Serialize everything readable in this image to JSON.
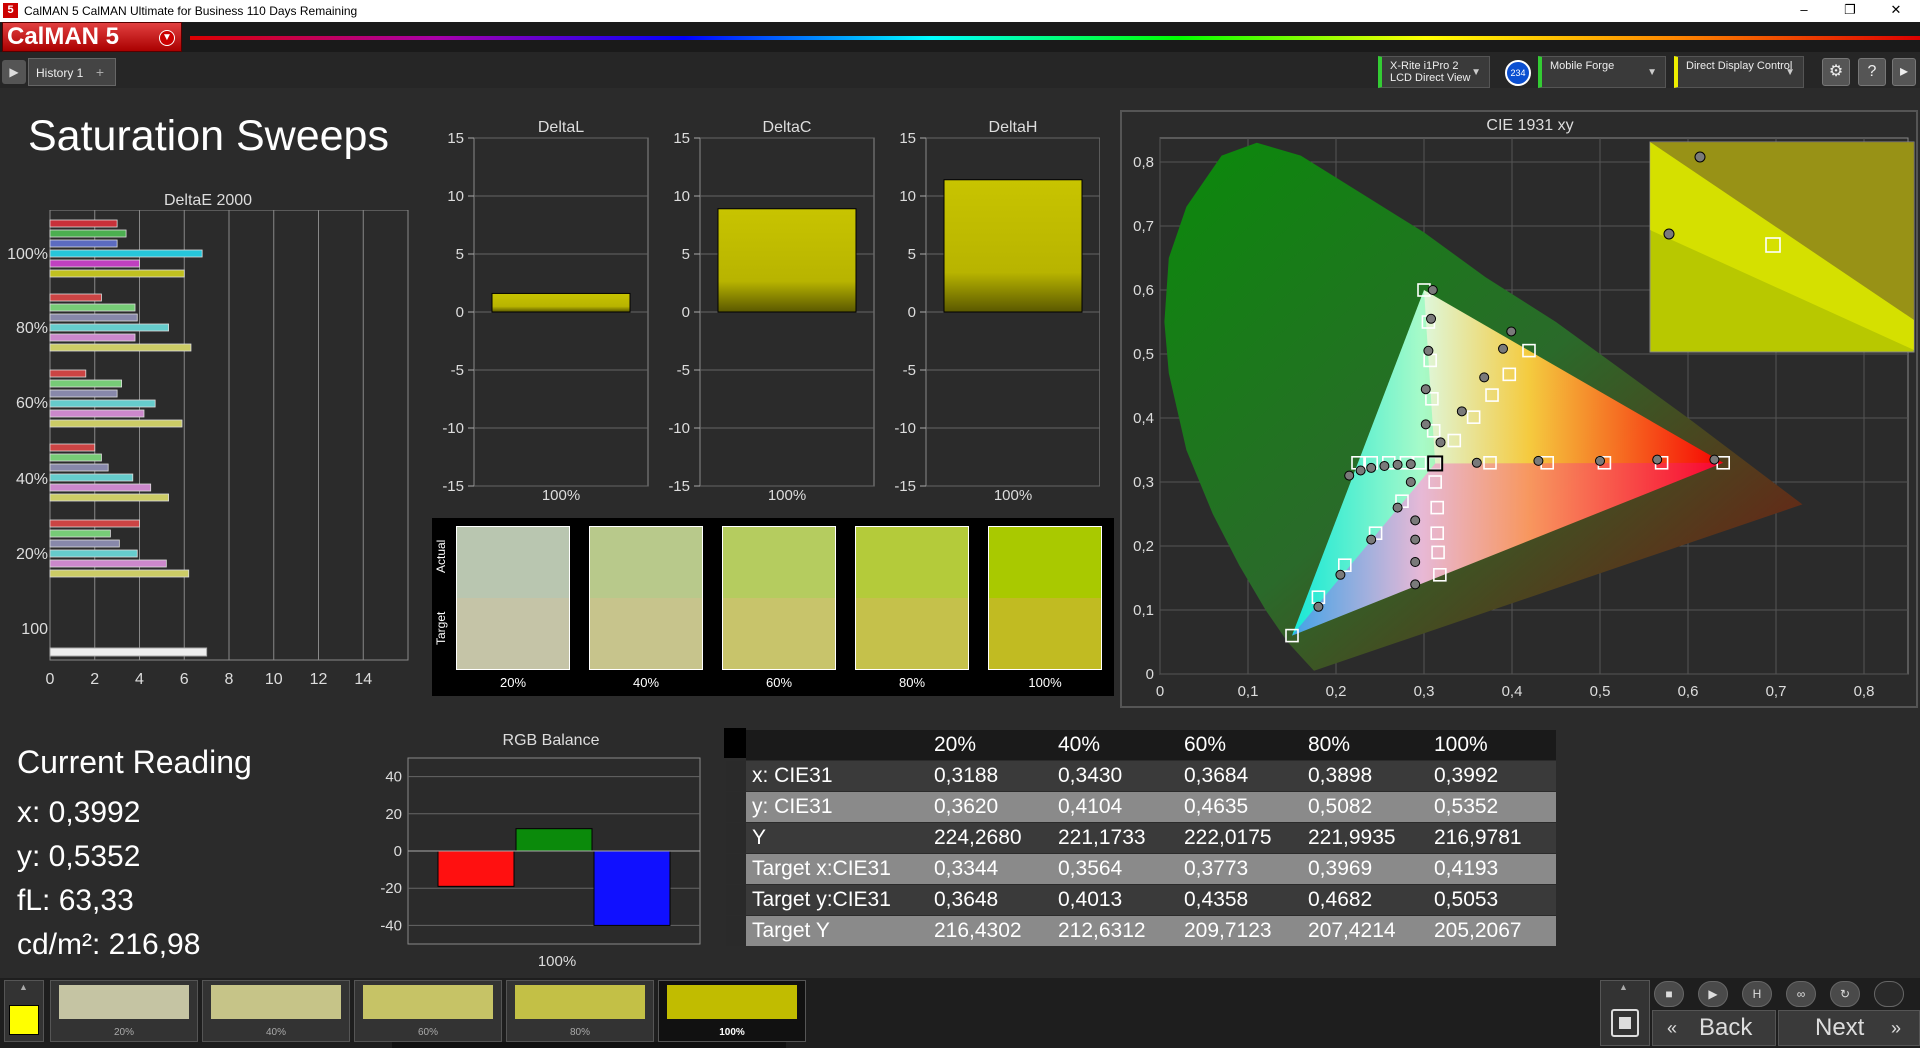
{
  "window": {
    "title": "CalMAN 5 CalMAN Ultimate for Business 110 Days Remaining",
    "app_icon": "5"
  },
  "logo": {
    "text": "CalMAN 5"
  },
  "tabs": {
    "history": "History 1",
    "add": "+"
  },
  "devices": [
    {
      "line1": "X-Rite i1Pro 2",
      "line2": "LCD Direct View",
      "accent": "#3c3"
    },
    {
      "line1": "Mobile Forge",
      "line2": "",
      "accent": "#3c3"
    },
    {
      "line1": "Direct Display Control",
      "line2": "",
      "accent": "#ee0"
    }
  ],
  "badge": "234",
  "toolbar_icons": [
    "gear-icon",
    "help-icon",
    "arrow-right-icon"
  ],
  "page_title": "Saturation Sweeps",
  "deltae_chart": {
    "title": "DeltaE 2000",
    "xticks": [
      "0",
      "2",
      "4",
      "6",
      "8",
      "10",
      "12",
      "14"
    ],
    "ylabels": [
      "100%",
      "80%",
      "60%",
      "40%",
      "20%",
      "100"
    ],
    "xlim": [
      0,
      16
    ]
  },
  "delta_charts": [
    {
      "title": "DeltaL",
      "value": 1.6,
      "xlabel": "100%"
    },
    {
      "title": "DeltaC",
      "value": 8.9,
      "xlabel": "100%"
    },
    {
      "title": "DeltaH",
      "value": 11.4,
      "xlabel": "100%"
    }
  ],
  "delta_yticks": [
    "15",
    "10",
    "5",
    "0",
    "-5",
    "-10",
    "-15"
  ],
  "swatches": {
    "actual_label": "Actual",
    "target_label": "Target",
    "items": [
      {
        "label": "20%",
        "actual": "#b9c6b0",
        "target": "#c5c4a7"
      },
      {
        "label": "40%",
        "actual": "#b8c98b",
        "target": "#c7c48c"
      },
      {
        "label": "60%",
        "actual": "#b5cc5f",
        "target": "#c8c46b"
      },
      {
        "label": "80%",
        "actual": "#b4cb3a",
        "target": "#c5c14b"
      },
      {
        "label": "100%",
        "actual": "#a9c900",
        "target": "#c1bb22"
      }
    ]
  },
  "cie": {
    "title": "CIE 1931 xy",
    "xticks": [
      "0",
      "0,1",
      "0,2",
      "0,3",
      "0,4",
      "0,5",
      "0,6",
      "0,7",
      "0,8"
    ],
    "yticks": [
      "0,8",
      "0,7",
      "0,6",
      "0,5",
      "0,4",
      "0,3",
      "0,2",
      "0,1",
      "0"
    ]
  },
  "current_reading": {
    "title": "Current Reading",
    "x": "x: 0,3992",
    "y": "y: 0,5352",
    "fl": "fL: 63,33",
    "cdm2": "cd/m²: 216,98"
  },
  "rgb_balance": {
    "title": "RGB Balance",
    "yticks": [
      "40",
      "20",
      "0",
      "-20",
      "-40"
    ],
    "xlabel": "100%",
    "values": {
      "red": -19,
      "green": 12,
      "blue": -40
    }
  },
  "table": {
    "headers": [
      "",
      "20%",
      "40%",
      "60%",
      "80%",
      "100%"
    ],
    "rows": [
      [
        "x: CIE31",
        "0,3188",
        "0,3430",
        "0,3684",
        "0,3898",
        "0,3992"
      ],
      [
        "y: CIE31",
        "0,3620",
        "0,4104",
        "0,4635",
        "0,5082",
        "0,5352"
      ],
      [
        "Y",
        "224,2680",
        "221,1733",
        "222,0175",
        "221,9935",
        "216,9781"
      ],
      [
        "Target x:CIE31",
        "0,3344",
        "0,3564",
        "0,3773",
        "0,3969",
        "0,4193"
      ],
      [
        "Target y:CIE31",
        "0,3648",
        "0,4013",
        "0,4358",
        "0,4682",
        "0,5053"
      ],
      [
        "Target Y",
        "216,4302",
        "212,6312",
        "209,7123",
        "207,4214",
        "205,2067"
      ]
    ]
  },
  "bottom_swatches": [
    {
      "label": "20%",
      "color": "#c5c4a3"
    },
    {
      "label": "40%",
      "color": "#c6c488"
    },
    {
      "label": "60%",
      "color": "#c6c366"
    },
    {
      "label": "80%",
      "color": "#c3c046"
    },
    {
      "label": "100%",
      "color": "#c1bc00"
    }
  ],
  "nav": {
    "back": "Back",
    "next": "Next"
  },
  "colors": {
    "accent_yellow": "#c1bc00",
    "active_swatch": "#ffff00"
  }
}
